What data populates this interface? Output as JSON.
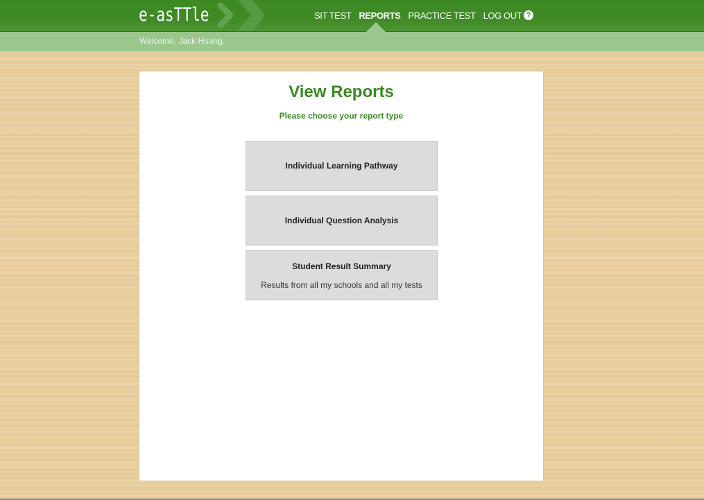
{
  "header": {
    "logo_text": "e-asTTle",
    "nav": [
      {
        "label": "SIT TEST",
        "active": false
      },
      {
        "label": "REPORTS",
        "active": true
      },
      {
        "label": "PRACTICE TEST",
        "active": false
      },
      {
        "label": "LOG OUT",
        "active": false
      }
    ],
    "help_icon": "?",
    "colors": {
      "brand_green": "#3d8a24",
      "subbar_green": "#9bc78c"
    }
  },
  "subbar": {
    "welcome": "Welcome, Jack Huang."
  },
  "main": {
    "title": "View Reports",
    "subtitle": "Please choose your report type",
    "options": [
      {
        "label": "Individual Learning Pathway",
        "description": ""
      },
      {
        "label": "Individual Question Analysis",
        "description": ""
      },
      {
        "label": "Student Result Summary",
        "description": "Results from all my schools and all my tests"
      }
    ]
  }
}
